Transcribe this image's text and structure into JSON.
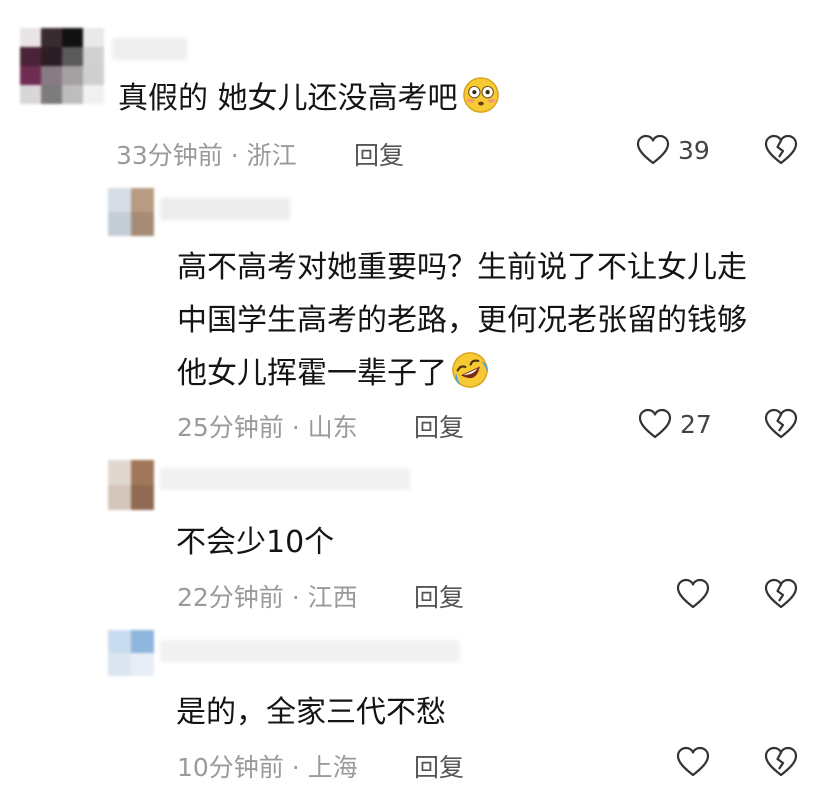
{
  "comments": [
    {
      "text_lines": [
        "真假的 她女儿还没高考吧"
      ],
      "emoji": "flushed-face-icon",
      "time": "33分钟前",
      "location": "浙江",
      "reply_label": "回复",
      "likes": "39"
    },
    {
      "text_lines": [
        "高不高考对她重要吗？生前说了不让女儿走",
        "中国学生高考的老路，更何况老张留的钱够",
        "他女儿挥霍一辈子了"
      ],
      "emoji": "rofl-face-icon",
      "time": "25分钟前",
      "location": "山东",
      "reply_label": "回复",
      "likes": "27"
    },
    {
      "text_lines": [
        "不会少10个"
      ],
      "time": "22分钟前",
      "location": "江西",
      "reply_label": "回复",
      "likes": ""
    },
    {
      "text_lines": [
        "是的，全家三代不愁"
      ],
      "time": "10分钟前",
      "location": "上海",
      "reply_label": "回复",
      "likes": ""
    }
  ],
  "separator": "·",
  "colors": {
    "text": "#141414",
    "meta": "#9a9a9a",
    "icon": "#333333"
  }
}
